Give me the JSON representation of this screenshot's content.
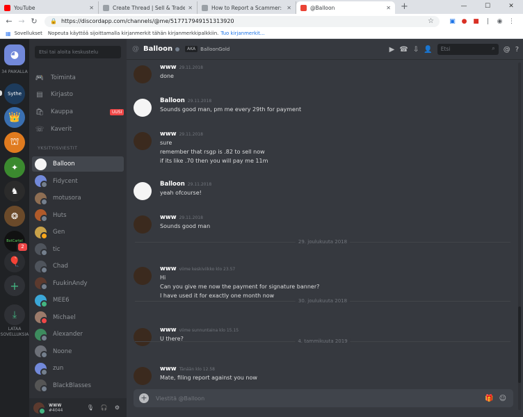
{
  "browser": {
    "tabs": [
      {
        "title": "YouTube",
        "fav_color": "#ff0000"
      },
      {
        "title": "Create Thread | Sell & Trade Gam",
        "fav_color": "#9aa0a6"
      },
      {
        "title": "How to Report a Scammer: Repo",
        "fav_color": "#9aa0a6"
      },
      {
        "title": "@Balloon",
        "fav_color": "#ea4335"
      }
    ],
    "new_tab": "+",
    "url": "https://discordapp.com/channels/@me/517717949151313920",
    "bookmarks_apps": "Sovellukset",
    "bookmarks_hint": "Nopeuta käyttöä sijoittamalla kirjanmerkit tähän kirjanmerkkipalkkiin.",
    "bookmarks_link": "Tuo kirjanmerkit..."
  },
  "guilds": {
    "online_label": "34 PAIKALLA",
    "download_label_1": "LATAA",
    "download_label_2": "SOVELLUKSIA",
    "badge": "2",
    "server_labels": {
      "sythe": "Sythe",
      "cartel": "BotCartel"
    }
  },
  "channels": {
    "search_placeholder": "Etsi tai aloita keskustelu",
    "nav": [
      {
        "label": "Toiminta",
        "icon": "🎮"
      },
      {
        "label": "Kirjasto",
        "icon": "▤"
      },
      {
        "label": "Kauppa",
        "icon": "🛍"
      },
      {
        "label": "Kaverit",
        "icon": "☏"
      }
    ],
    "new_badge": "UUSI",
    "dm_header": "YKSITYISVIESTIT",
    "dms": [
      {
        "name": "Balloon",
        "color": "#f5f5f5",
        "status": ""
      },
      {
        "name": "Fidycent",
        "color": "#7289da",
        "status": "#747f8d"
      },
      {
        "name": "motusora",
        "color": "#8e6e53",
        "status": "#747f8d"
      },
      {
        "name": "Huts",
        "color": "#b05a2a",
        "status": "#747f8d"
      },
      {
        "name": "Gen",
        "color": "#c9a24a",
        "status": "#faa61a"
      },
      {
        "name": "tic",
        "color": "#4f545c",
        "status": "#747f8d"
      },
      {
        "name": "Chad",
        "color": "#4f545c",
        "status": "#747f8d"
      },
      {
        "name": "FuukinAndy",
        "color": "#5c3a2e",
        "status": "#747f8d"
      },
      {
        "name": "MEE6",
        "color": "#3ba7d8",
        "status": "#43b581"
      },
      {
        "name": "Michael",
        "color": "#9c7b6b",
        "status": "#f04747"
      },
      {
        "name": "Alexander",
        "color": "#3d8b5e",
        "status": "#747f8d"
      },
      {
        "name": "Noone",
        "color": "#6d7078",
        "status": "#747f8d"
      },
      {
        "name": "zun",
        "color": "#7289da",
        "status": "#747f8d"
      },
      {
        "name": "BlackBlasses",
        "color": "#555",
        "status": "#747f8d"
      }
    ]
  },
  "user": {
    "name": "www",
    "tag": "#4044"
  },
  "chat": {
    "title": "Balloon",
    "aka": "AKA",
    "aka_name": "BalloonGold",
    "search_placeholder": "Etsi",
    "composer_placeholder": "Viestitä @Balloon",
    "messages": [
      {
        "author": "www",
        "time": "29.11.2018",
        "lines": [
          "done"
        ],
        "avatar": "dark"
      },
      {
        "author": "Balloon",
        "time": "29.11.2018",
        "lines": [
          "Sounds good man, pm me every 29th for payment"
        ],
        "avatar": "balloon"
      },
      {
        "author": "www",
        "time": "29.11.2018",
        "lines": [
          "sure",
          "remember that rsgp is .82 to sell now",
          "if its like .70 then you will pay me 11m"
        ],
        "avatar": "dark"
      },
      {
        "author": "Balloon",
        "time": "29.11.2018",
        "lines": [
          "yeah ofcourse!"
        ],
        "avatar": "balloon"
      },
      {
        "author": "www",
        "time": "29.11.2018",
        "lines": [
          "Sounds good man"
        ],
        "avatar": "dark"
      },
      {
        "author": "www",
        "time": "viime keskiviikko klo 23.57",
        "lines": [
          "Hi",
          "Can you give me now the payment for signature banner?",
          "I have used it for exactly one month now"
        ],
        "avatar": "dark"
      },
      {
        "author": "www",
        "time": "viime sunnuntaina klo 15.15",
        "lines": [
          "U there?"
        ],
        "avatar": "dark"
      },
      {
        "author": "www",
        "time": "Tänään klo 12.58",
        "lines": [
          "Mate, filing report against you now"
        ],
        "avatar": "dark"
      }
    ],
    "dividers": [
      "29. joulukuuta 2018",
      "30. joulukuuta 2018",
      "4. tammikuuta 2019"
    ]
  }
}
